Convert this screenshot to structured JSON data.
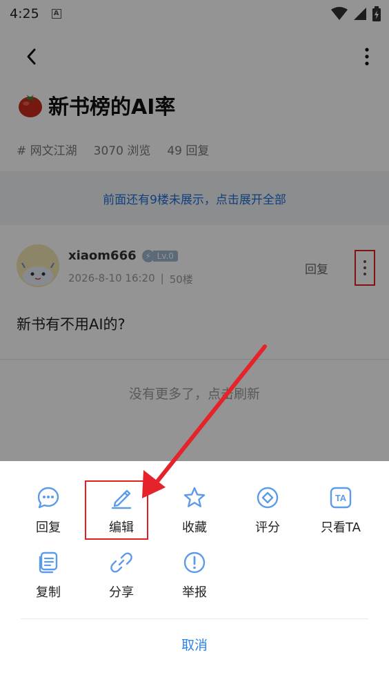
{
  "status": {
    "time": "4:25",
    "a_indicator": "A"
  },
  "post": {
    "title": "新书榜的AI率",
    "tag": "# 网文江湖",
    "views": "3070 浏览",
    "replies": "49 回复",
    "expand_text": "前面还有9楼未展示，点击展开全部"
  },
  "comment": {
    "username": "xiaom666",
    "level": "Lv.0",
    "date": "2026-8-10 16:20",
    "separator": "|",
    "floor": "50楼",
    "reply_label": "回复",
    "body": "新书有不用AI的?"
  },
  "no_more_text": "没有更多了，点击刷新",
  "sheet": {
    "actions": [
      {
        "label": "回复",
        "icon": "chat-bubble-icon"
      },
      {
        "label": "编辑",
        "icon": "pencil-icon"
      },
      {
        "label": "收藏",
        "icon": "star-icon"
      },
      {
        "label": "评分",
        "icon": "diamond-rating-icon"
      },
      {
        "label": "只看TA",
        "icon": "ta-icon"
      },
      {
        "label": "复制",
        "icon": "copy-icon"
      },
      {
        "label": "分享",
        "icon": "link-icon"
      },
      {
        "label": "举报",
        "icon": "report-icon"
      }
    ],
    "ta_icon_text": "TA",
    "cancel_label": "取消"
  },
  "colors": {
    "accent": "#2a83e6",
    "annotation": "#e02020",
    "icon": "#5b9bea"
  }
}
